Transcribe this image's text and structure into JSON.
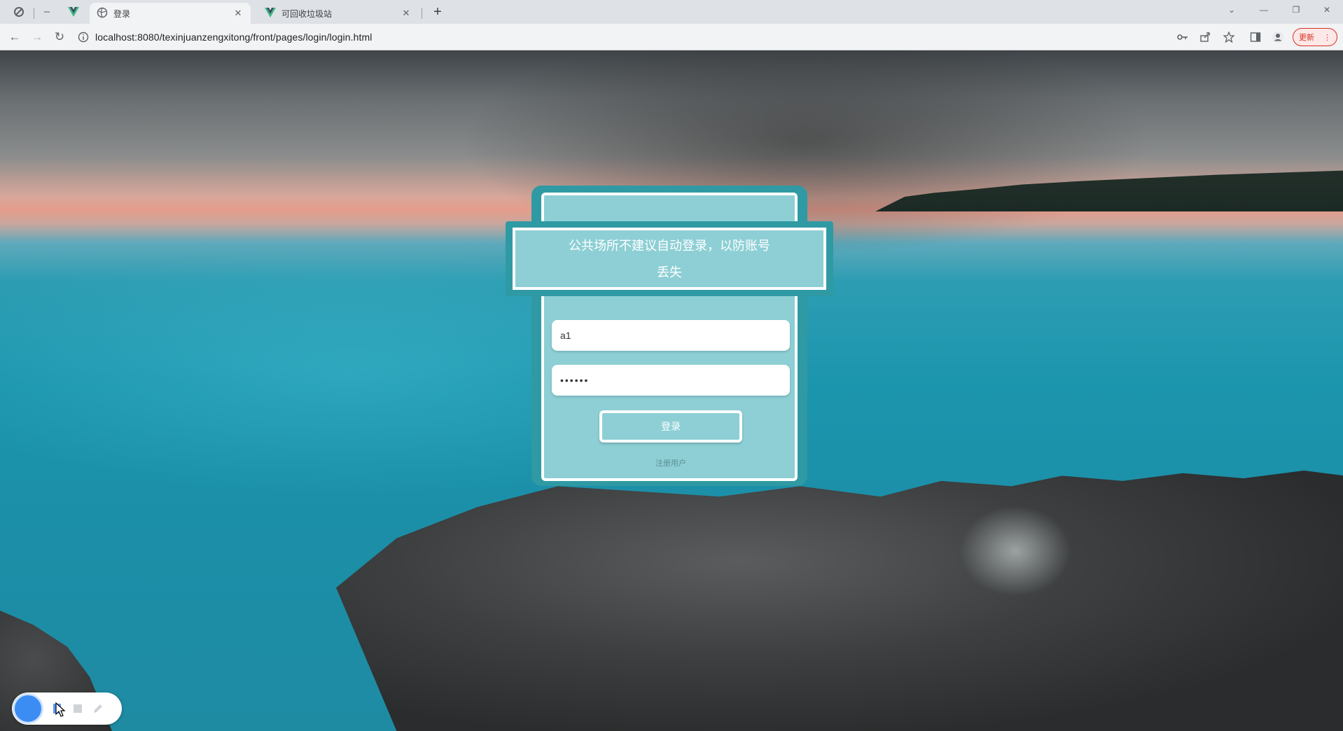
{
  "browser": {
    "tabs": [
      {
        "title": "登录",
        "active": true
      },
      {
        "title": "可回收垃圾站",
        "active": false
      }
    ],
    "url": "localhost:8080/texinjuanzengxitong/front/pages/login/login.html",
    "update_label": "更新"
  },
  "login": {
    "banner": "公共场所不建议自动登录，以防账号丢失",
    "username_value": "a1",
    "password_value": "••••••",
    "login_button": "登录",
    "register_link": "注册用户"
  },
  "colors": {
    "card_border": "#2f9aa3",
    "card_fill": "#8dcfd5",
    "accent": "#3b8df3"
  }
}
